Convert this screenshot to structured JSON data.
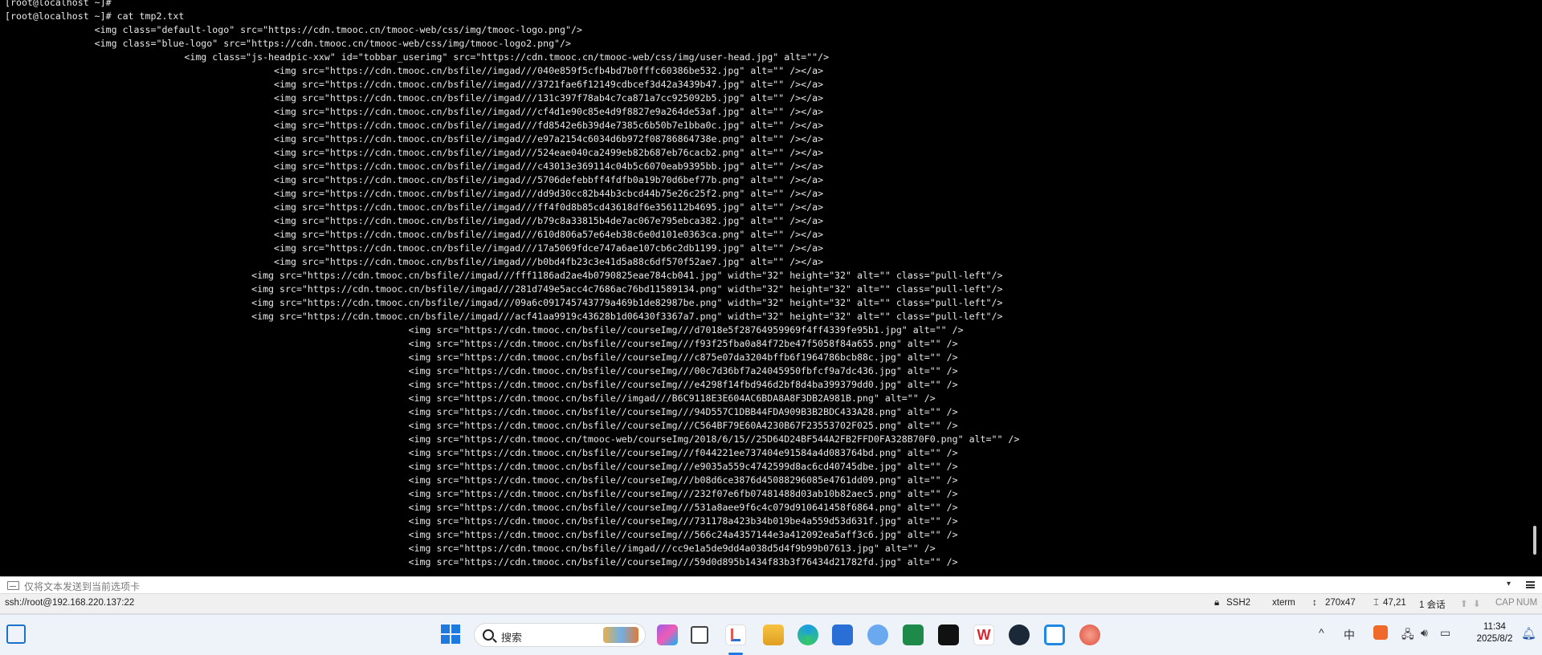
{
  "terminal": {
    "lines": [
      "[root@localhost ~]#",
      "[root@localhost ~]# cat tmp2.txt",
      "                <img class=\"default-logo\" src=\"https://cdn.tmooc.cn/tmooc-web/css/img/tmooc-logo.png\"/>",
      "                <img class=\"blue-logo\" src=\"https://cdn.tmooc.cn/tmooc-web/css/img/tmooc-logo2.png\"/>",
      "                                <img class=\"js-headpic-xxw\" id=\"tobbar_userimg\" src=\"https://cdn.tmooc.cn/tmooc-web/css/img/user-head.jpg\" alt=\"\"/>",
      "                                                <img src=\"https://cdn.tmooc.cn/bsfile//imgad///040e859f5cfb4bd7b0fffc60386be532.jpg\" alt=\"\" /></a>",
      "                                                <img src=\"https://cdn.tmooc.cn/bsfile//imgad///3721fae6f12149cdbcef3d42a3439b47.jpg\" alt=\"\" /></a>",
      "                                                <img src=\"https://cdn.tmooc.cn/bsfile//imgad///131c397f78ab4c7ca871a7cc925092b5.jpg\" alt=\"\" /></a>",
      "                                                <img src=\"https://cdn.tmooc.cn/bsfile//imgad///cf4d1e90c85e4d9f8827e9a264de53af.jpg\" alt=\"\" /></a>",
      "                                                <img src=\"https://cdn.tmooc.cn/bsfile//imgad///fd8542e6b39d4e7385c6b50b7e1bba0c.jpg\" alt=\"\" /></a>",
      "                                                <img src=\"https://cdn.tmooc.cn/bsfile//imgad///e97a2154c6034d6b972f08786864738e.png\" alt=\"\" /></a>",
      "                                                <img src=\"https://cdn.tmooc.cn/bsfile//imgad///524eae040ca2499eb82b687eb76cacb2.png\" alt=\"\" /></a>",
      "                                                <img src=\"https://cdn.tmooc.cn/bsfile//imgad///c43013e369114c04b5c6070eab9395bb.jpg\" alt=\"\" /></a>",
      "                                                <img src=\"https://cdn.tmooc.cn/bsfile//imgad///5706defebbff4fdfb0a19b70d6bef77b.png\" alt=\"\" /></a>",
      "                                                <img src=\"https://cdn.tmooc.cn/bsfile//imgad///dd9d30cc82b44b3cbcd44b75e26c25f2.png\" alt=\"\" /></a>",
      "                                                <img src=\"https://cdn.tmooc.cn/bsfile//imgad///ff4f0d8b85cd43618df6e356112b4695.jpg\" alt=\"\" /></a>",
      "                                                <img src=\"https://cdn.tmooc.cn/bsfile//imgad///b79c8a33815b4de7ac067e795ebca382.jpg\" alt=\"\" /></a>",
      "                                                <img src=\"https://cdn.tmooc.cn/bsfile//imgad///610d806a57e64eb38c6e0d101e0363ca.png\" alt=\"\" /></a>",
      "                                                <img src=\"https://cdn.tmooc.cn/bsfile//imgad///17a5069fdce747a6ae107cb6c2db1199.jpg\" alt=\"\" /></a>",
      "                                                <img src=\"https://cdn.tmooc.cn/bsfile//imgad///b0bd4fb23c3e41d5a88c6df570f52ae7.jpg\" alt=\"\" /></a>",
      "                                            <img src=\"https://cdn.tmooc.cn/bsfile//imgad///fff1186ad2ae4b0790825eae784cb041.jpg\" width=\"32\" height=\"32\" alt=\"\" class=\"pull-left\"/>",
      "                                            <img src=\"https://cdn.tmooc.cn/bsfile//imgad///281d749e5acc4c7686ac76bd11589134.png\" width=\"32\" height=\"32\" alt=\"\" class=\"pull-left\"/>",
      "                                            <img src=\"https://cdn.tmooc.cn/bsfile//imgad///09a6c091745743779a469b1de82987be.png\" width=\"32\" height=\"32\" alt=\"\" class=\"pull-left\"/>",
      "                                            <img src=\"https://cdn.tmooc.cn/bsfile//imgad///acf41aa9919c43628b1d06430f3367a7.png\" width=\"32\" height=\"32\" alt=\"\" class=\"pull-left\"/>",
      "                                                                        <img src=\"https://cdn.tmooc.cn/bsfile//courseImg///d7018e5f28764959969f4ff4339fe95b1.jpg\" alt=\"\" />",
      "                                                                        <img src=\"https://cdn.tmooc.cn/bsfile//courseImg///f93f25fba0a84f72be47f5058f84a655.png\" alt=\"\" />",
      "                                                                        <img src=\"https://cdn.tmooc.cn/bsfile//courseImg///c875e07da3204bffb6f1964786bcb88c.jpg\" alt=\"\" />",
      "                                                                        <img src=\"https://cdn.tmooc.cn/bsfile//courseImg///00c7d36bf7a24045950fbfcf9a7dc436.jpg\" alt=\"\" />",
      "                                                                        <img src=\"https://cdn.tmooc.cn/bsfile//courseImg///e4298f14fbd946d2bf8d4ba399379dd0.jpg\" alt=\"\" />",
      "                                                                        <img src=\"https://cdn.tmooc.cn/bsfile//imgad///B6C9118E3E604AC6BDA8A8F3DB2A981B.png\" alt=\"\" />",
      "                                                                        <img src=\"https://cdn.tmooc.cn/bsfile//courseImg///94D557C1DBB44FDA909B3B2BDC433A28.png\" alt=\"\" />",
      "                                                                        <img src=\"https://cdn.tmooc.cn/bsfile//courseImg///C564BF79E60A4230B67F23553702F025.png\" alt=\"\" />",
      "                                                                        <img src=\"https://cdn.tmooc.cn/tmooc-web/courseImg/2018/6/15//25D64D24BF544A2FB2FFD0FA328B70F0.png\" alt=\"\" />",
      "                                                                        <img src=\"https://cdn.tmooc.cn/bsfile//courseImg///f044221ee737404e91584a4d083764bd.png\" alt=\"\" />",
      "                                                                        <img src=\"https://cdn.tmooc.cn/bsfile//courseImg///e9035a559c4742599d8ac6cd40745dbe.jpg\" alt=\"\" />",
      "                                                                        <img src=\"https://cdn.tmooc.cn/bsfile//courseImg///b08d6ce3876d45088296085e4761dd09.png\" alt=\"\" />",
      "                                                                        <img src=\"https://cdn.tmooc.cn/bsfile//courseImg///232f07e6fb07481488d03ab10b82aec5.png\" alt=\"\" />",
      "                                                                        <img src=\"https://cdn.tmooc.cn/bsfile//courseImg///531a8aee9f6c4c079d910641458f6864.png\" alt=\"\" />",
      "                                                                        <img src=\"https://cdn.tmooc.cn/bsfile//courseImg///731178a423b34b019be4a559d53d631f.jpg\" alt=\"\" />",
      "                                                                        <img src=\"https://cdn.tmooc.cn/bsfile//courseImg///566c24a4357144e3a412092ea5aff3c6.jpg\" alt=\"\" />",
      "                                                                        <img src=\"https://cdn.tmooc.cn/bsfile//imgad///cc9e1a5de9dd4a038d5d4f9b99b07613.jpg\" alt=\"\" />",
      "                                                                        <img src=\"https://cdn.tmooc.cn/bsfile//courseImg///59d0d895b1434f83b3f76434d21782fd.jpg\" alt=\"\" />"
    ]
  },
  "scrollbar": {
    "thumb_position": 0.92,
    "thumb_size": 0.05
  },
  "sendbar": {
    "placeholder": "仅将文本发送到当前选项卡",
    "dropdown_glyph": "▾"
  },
  "status": {
    "connection": "ssh://root@192.168.220.137:22",
    "protocol": "SSH2",
    "terminal_type": "xterm",
    "size": "270x47",
    "cursor_pos": "47,21",
    "sessions": "1 会话",
    "caps": "CAP",
    "num": "NUM"
  },
  "taskbar": {
    "search_label": "搜索",
    "time": "11:34",
    "date": "2025/8/2",
    "icons": [
      {
        "name": "widgets-icon",
        "color": "#1a73c8"
      },
      {
        "name": "windows-start-icon",
        "color": "#1f7ae0"
      },
      {
        "name": "copilot-icon",
        "color": "#9b5de5"
      },
      {
        "name": "task-view-icon",
        "color": "#444444"
      },
      {
        "name": "xshell-icon",
        "color": "#e85a4f"
      },
      {
        "name": "file-explorer-icon",
        "color": "#f0b429"
      },
      {
        "name": "edge-icon",
        "color": "#1b9de2"
      },
      {
        "name": "store-icon",
        "color": "#2a6fd6"
      },
      {
        "name": "control-panel-icon",
        "color": "#3c8ce7"
      },
      {
        "name": "gitkraken-icon",
        "color": "#1d8a4a"
      },
      {
        "name": "capcut-icon",
        "color": "#111111"
      },
      {
        "name": "wps-icon",
        "color": "#d9282f"
      },
      {
        "name": "steam-icon",
        "color": "#1b2838"
      },
      {
        "name": "screenshot-app-icon",
        "color": "#1e88e5"
      },
      {
        "name": "snail-app-icon",
        "color": "#e04e3c"
      }
    ]
  }
}
